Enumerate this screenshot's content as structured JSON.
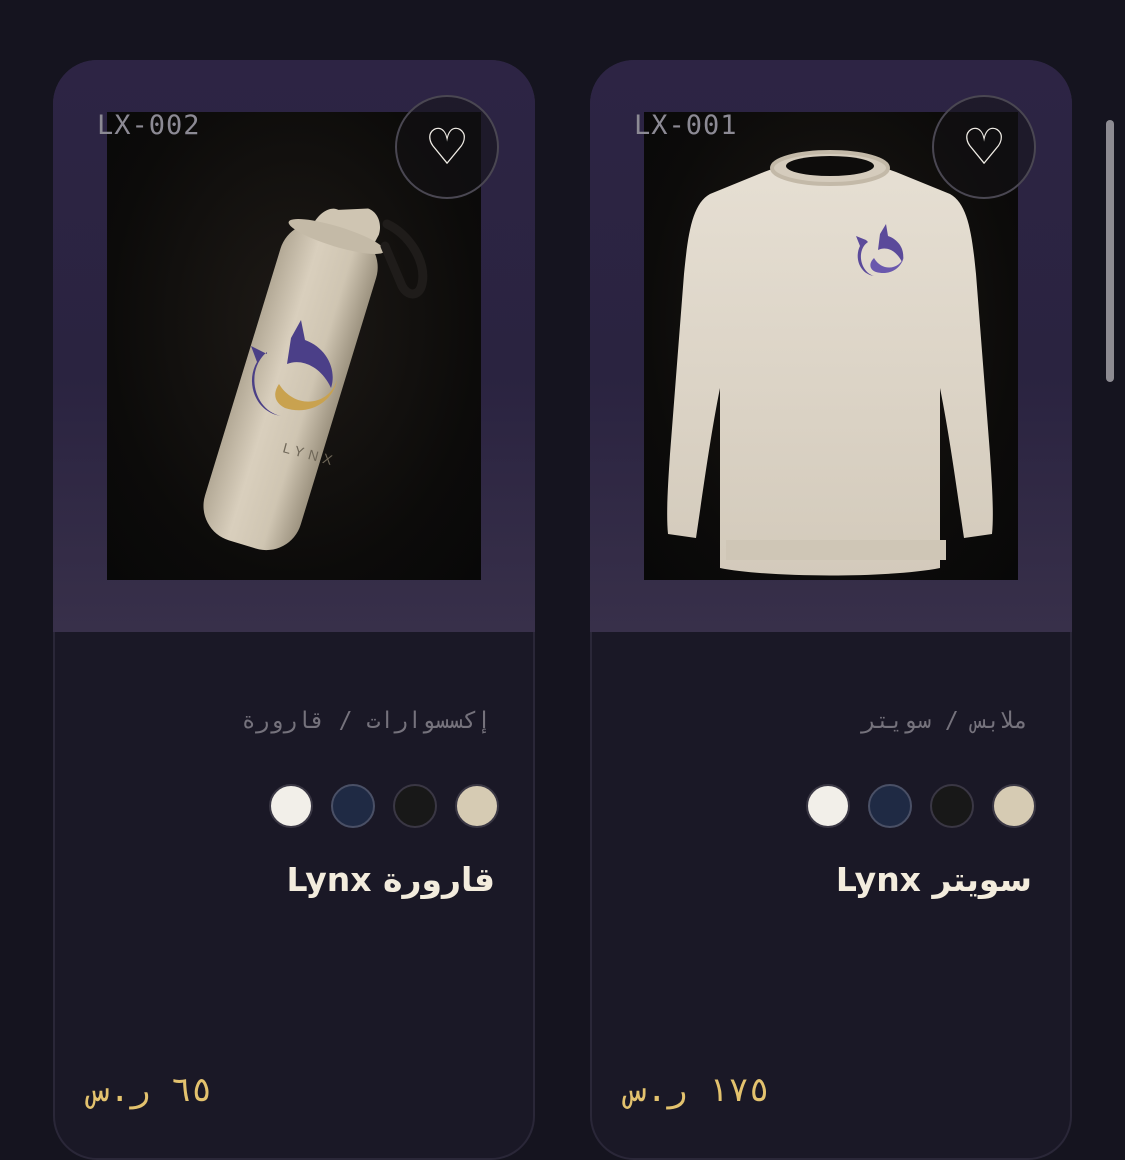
{
  "products": [
    {
      "code": "LX-002",
      "category": "إكسسوارات / قارورة",
      "name": "قارورة Lynx",
      "price": "٦٥ ر.س",
      "image_label": "LYNX",
      "swatches": [
        "#f2efe9",
        "#1f2a44",
        "#181818",
        "#d6cbb3"
      ],
      "favorite_icon": "heart-outline-icon"
    },
    {
      "code": "LX-001",
      "category": "ملابس / سويتر",
      "name": "سويتر Lynx",
      "price": "١٧٥ ر.س",
      "swatches": [
        "#f2efe9",
        "#1f2a44",
        "#181818",
        "#d6cbb3"
      ],
      "favorite_icon": "heart-outline-icon"
    }
  ],
  "colors": {
    "background": "#15141f",
    "card": "#1a1826",
    "card_top": "#2d2444",
    "price": "#e3c26e",
    "brand_purple": "#5b4a9a"
  }
}
